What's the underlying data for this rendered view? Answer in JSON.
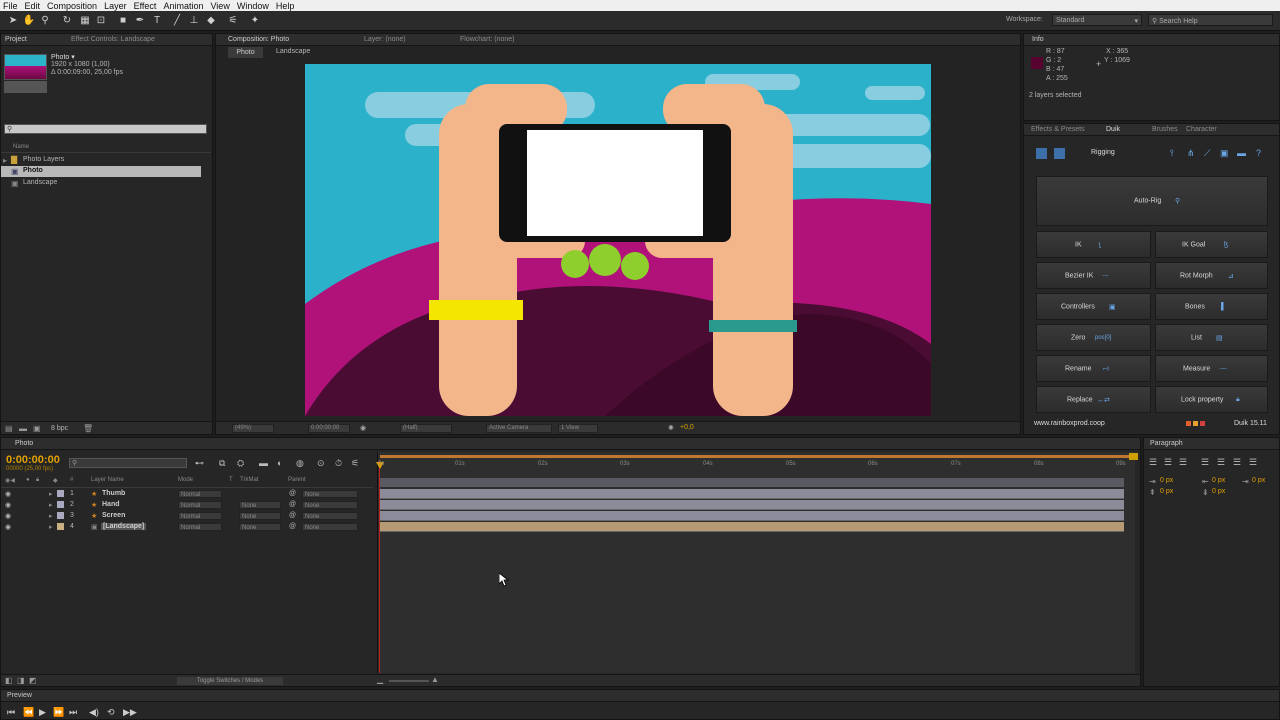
{
  "menu": [
    "File",
    "Edit",
    "Composition",
    "Layer",
    "Effect",
    "Animation",
    "View",
    "Window",
    "Help"
  ],
  "workspace": {
    "label": "Workspace:",
    "value": "Standard",
    "search_placeholder": "Search Help"
  },
  "project_panel": {
    "tabs": [
      "Project",
      "Effect Controls: Landscape"
    ],
    "item_name": "Photo ▾",
    "item_info1": "1920 x 1080 (1,00)",
    "item_info2": "Δ 0:00:09:00, 25,00 fps",
    "col_name": "Name",
    "items": [
      {
        "label": "Photo Layers"
      },
      {
        "label": "Photo"
      },
      {
        "label": "Landscape"
      }
    ],
    "bpc": "8 bpc"
  },
  "comp_panel": {
    "tabs": [
      "Composition: Photo",
      "Layer: (none)",
      "Flowchart: (none)"
    ],
    "breadcrumbs": [
      "Photo",
      "Landscape"
    ],
    "zoom": "(49%)",
    "timecode": "0:00:00:00",
    "resolution": "(Half)",
    "camera": "Active Camera",
    "view": "1 View",
    "exposure": "+0,0"
  },
  "info_panel": {
    "tab": "Info",
    "r": "R : 87",
    "g": "G : 2",
    "b": "B : 47",
    "a": "A : 255",
    "x": "X : 365",
    "y": "Y : 1069",
    "status": "2 layers selected",
    "swatch": "#57022f"
  },
  "duik_panel": {
    "tabs": [
      "Effects & Presets",
      "Duik",
      "Brushes",
      "Character"
    ],
    "section": "Rigging",
    "auto_rig": "Auto-Rig",
    "buttons": [
      {
        "label": "IK",
        "icon": "ik-icon"
      },
      {
        "label": "IK Goal",
        "icon": "ik-goal-icon"
      },
      {
        "label": "Bezier IK",
        "icon": "bezier-ik-icon"
      },
      {
        "label": "Rot Morph",
        "icon": "rot-morph-icon"
      },
      {
        "label": "Controllers",
        "icon": "controllers-icon"
      },
      {
        "label": "Bones",
        "icon": "bones-icon"
      },
      {
        "label": "Zero",
        "icon": "zero-icon"
      },
      {
        "label": "List",
        "icon": "list-icon"
      },
      {
        "label": "Rename",
        "icon": "rename-icon"
      },
      {
        "label": "Measure",
        "icon": "measure-icon"
      },
      {
        "label": "Replace",
        "icon": "replace-icon"
      },
      {
        "label": "Lock property",
        "icon": "lock-icon"
      }
    ],
    "zero_icon_text": "pos[0]",
    "website": "www.rainboxprod.coop",
    "version": "Duik 15.11"
  },
  "timeline": {
    "tab": "Photo",
    "timecode": "0:00:00:00",
    "fps": "00000 (25,00 fps)",
    "columns": {
      "num": "#",
      "name": "Layer Name",
      "mode": "Mode",
      "t": "T",
      "trkmat": "TrkMat",
      "parent": "Parent"
    },
    "layers": [
      {
        "num": "1",
        "name": "Thumb",
        "mode": "Normal",
        "trkmat": "",
        "parent": "None"
      },
      {
        "num": "2",
        "name": "Hand",
        "mode": "Normal",
        "trkmat": "None",
        "parent": "None"
      },
      {
        "num": "3",
        "name": "Screen",
        "mode": "Normal",
        "trkmat": "None",
        "parent": "None"
      },
      {
        "num": "4",
        "name": "[Landscape]",
        "mode": "Normal",
        "trkmat": "None",
        "parent": "None"
      }
    ],
    "ruler": [
      "0s",
      "01s",
      "02s",
      "03s",
      "04s",
      "05s",
      "06s",
      "07s",
      "08s",
      "09s"
    ],
    "toggle_label": "Toggle Switches / Modes"
  },
  "paragraph_panel": {
    "tab": "Paragraph",
    "values": [
      "0 px",
      "0 px",
      "0 px",
      "0 px",
      "0 px"
    ]
  },
  "preview_panel": {
    "tab": "Preview"
  }
}
